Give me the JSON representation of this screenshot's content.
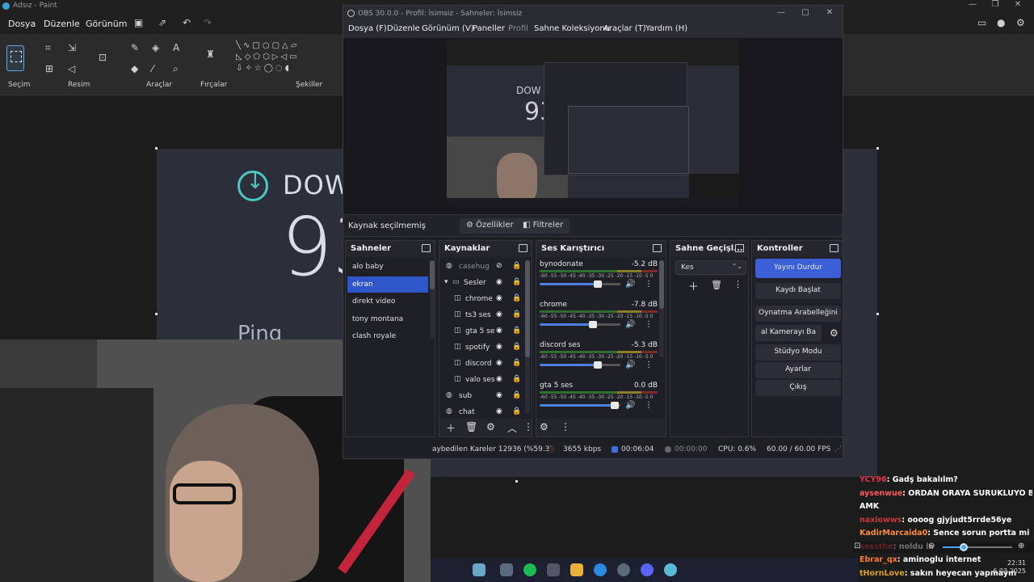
{
  "paint": {
    "title": "Adsız - Paint",
    "menu": [
      "Dosya",
      "Düzenle",
      "Görünüm"
    ],
    "groups": [
      "Seçim",
      "Resim",
      "Araçlar",
      "Fırçalar",
      "Şekiller"
    ]
  },
  "canvas_content": {
    "download_label": "DOW",
    "speed_value": "93",
    "ping_label": "Ping"
  },
  "obs": {
    "title": "OBS 30.0.0 - Profil: İsimsiz - Sahneler: İsimsiz",
    "menu": [
      {
        "label": "Dosya (F)",
        "dim": false
      },
      {
        "label": "Düzenle",
        "dim": false
      },
      {
        "label": "Görünüm (V)",
        "dim": false
      },
      {
        "label": "Paneller",
        "dim": false
      },
      {
        "label": "Profil",
        "dim": true
      },
      {
        "label": "Sahne Koleksiyonu",
        "dim": false
      },
      {
        "label": "Araçlar (T)",
        "dim": false
      },
      {
        "label": "Yardım (H)",
        "dim": false
      }
    ],
    "preview": {
      "down": "DOW",
      "value": "93"
    },
    "source_toolbar": {
      "no_source": "Kaynak seçilmemiş",
      "properties": "Özellikler",
      "filters": "Filtreler"
    },
    "docks": {
      "scenes": "Sahneler",
      "sources": "Kaynaklar",
      "mixer": "Ses Karıştırıcı",
      "transitions": "Sahne Geçişl...",
      "controls": "Kontroller"
    },
    "scenes": [
      "alo baby",
      "ekran",
      "direkt video",
      "tony montana",
      "clash royale"
    ],
    "active_scene_index": 1,
    "sources": [
      {
        "name": "casehug",
        "icon": "◍",
        "indent": false,
        "dim": true
      },
      {
        "name": "Sesler",
        "icon": "▭",
        "indent": false,
        "dim": false,
        "group": true
      },
      {
        "name": "chrome",
        "icon": "◫",
        "indent": true,
        "dim": false
      },
      {
        "name": "ts3 ses",
        "icon": "◫",
        "indent": true,
        "dim": false
      },
      {
        "name": "gta 5 se",
        "icon": "◫",
        "indent": true,
        "dim": false
      },
      {
        "name": "spotify",
        "icon": "◫",
        "indent": true,
        "dim": false
      },
      {
        "name": "discord",
        "icon": "◫",
        "indent": true,
        "dim": false
      },
      {
        "name": "valo ses",
        "icon": "◫",
        "indent": true,
        "dim": false
      },
      {
        "name": "sub",
        "icon": "◍",
        "indent": false,
        "dim": false
      },
      {
        "name": "chat",
        "icon": "◍",
        "indent": false,
        "dim": false
      }
    ],
    "mixer": [
      {
        "name": "bynodonate",
        "db": "-5.2 dB",
        "level": 0.72
      },
      {
        "name": "chrome",
        "db": "-7.8 dB",
        "level": 0.66
      },
      {
        "name": "discord ses",
        "db": "-5.3 dB",
        "level": 0.72
      },
      {
        "name": "gta 5 ses",
        "db": "0.0 dB",
        "level": 0.93
      }
    ],
    "mixer_scale": "-60 -55 -50 -45 -40 -35 -30 -25 -20 -15 -10 -5 0",
    "transition": "Kes",
    "controls": [
      {
        "label": "Yayını Durdur",
        "primary": true
      },
      {
        "label": "Kaydı Başlat",
        "primary": false
      },
      {
        "label": "Oynatma Arabelleğini",
        "primary": false
      },
      {
        "label": "al Kamerayı Ba",
        "primary": false
      },
      {
        "label": "Stüdyo Modu",
        "primary": false
      },
      {
        "label": "Ayarlar",
        "primary": false
      },
      {
        "label": "Çıkış",
        "primary": false
      }
    ],
    "status": {
      "dropped": "aybedilen Kareler 12936 (%59.3)",
      "bitrate": "3655 kbps",
      "live_time": "00:06:04",
      "rec_time": "00:00:00",
      "cpu": "CPU: 0.6%",
      "fps": "60.00 / 60.00 FPS"
    }
  },
  "chat": [
    {
      "user": "YCY96",
      "msg": ": Gadş bakalılm?",
      "color": "#e0344a"
    },
    {
      "user": "aysenwue",
      "msg": ": ORDAN ORAYA SURUKLUYO BIZI",
      "color": "#ff5a5a"
    },
    {
      "user": "",
      "msg": "AMK",
      "color": "#ffffff"
    },
    {
      "user": "naxiowws",
      "msg": ": oooog gjyjudt5rrde56ye",
      "color": "#c73a3a"
    },
    {
      "user": "KadirMarcaida0",
      "msg": ": Sence sorun portta mi esek",
      "color": "#ff8c3a"
    },
    {
      "user": "xessthe",
      "msg": ": noldu la",
      "color": "#d23a3a"
    },
    {
      "user": "Ebrar_qx",
      "msg": ": aminoglu internet",
      "color": "#ff7a2a"
    },
    {
      "user": "tHornLove",
      "msg": ": sakın heyecan yapmayın",
      "color": "#e0a020"
    }
  ],
  "clock": {
    "time": "22:31",
    "date": "6.03.2025"
  },
  "zoom_level": 0.3
}
